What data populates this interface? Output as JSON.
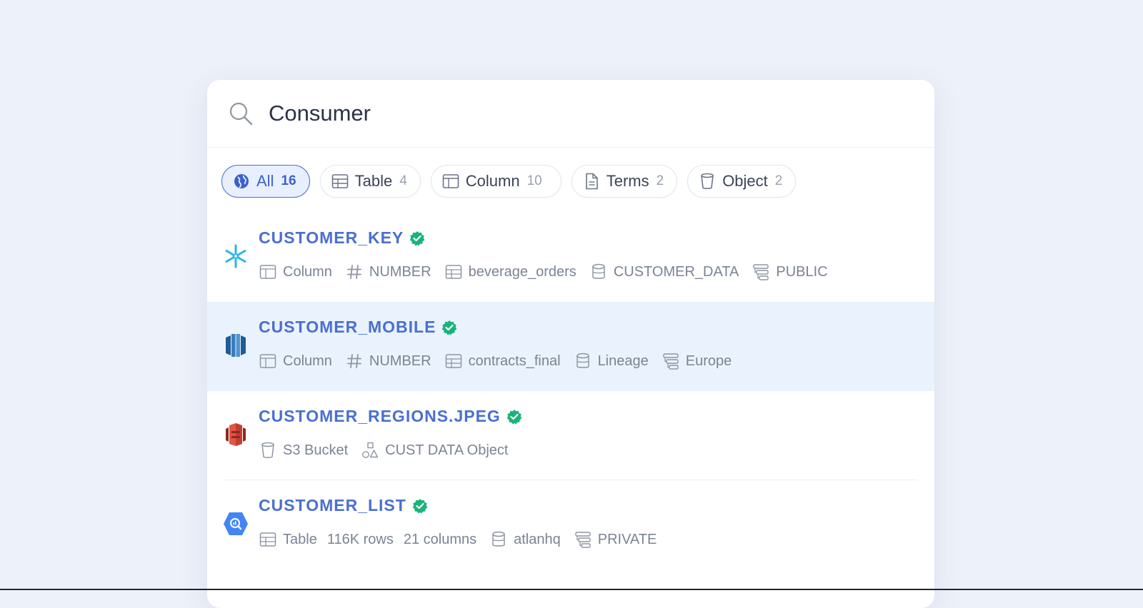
{
  "search": {
    "query": "Consumer",
    "icon": "search-icon"
  },
  "filters": [
    {
      "label": "All",
      "count": "16",
      "icon": "globe-icon"
    },
    {
      "label": "Table",
      "count": "4",
      "icon": "table-icon"
    },
    {
      "label": "Column",
      "count": "10",
      "icon": "column-icon"
    },
    {
      "label": "Terms",
      "count": "2",
      "icon": "document-icon"
    },
    {
      "label": "Object",
      "count": "2",
      "icon": "bucket-icon"
    }
  ],
  "results": [
    {
      "title": "CUSTOMER_KEY",
      "source_icon": "snowflake-icon",
      "meta": [
        "Column",
        "NUMBER",
        "beverage_orders",
        "CUSTOMER_DATA",
        "PUBLIC"
      ]
    },
    {
      "title": "CUSTOMER_MOBILE",
      "source_icon": "redshift-icon",
      "meta": [
        "Column",
        "NUMBER",
        "contracts_final",
        "Lineage",
        "Europe"
      ]
    },
    {
      "title": "CUSTOMER_REGIONS.JPEG",
      "source_icon": "s3-icon",
      "meta": [
        "S3 Bucket",
        "CUST DATA Object"
      ]
    },
    {
      "title": "CUSTOMER_LIST",
      "source_icon": "bigquery-icon",
      "meta": [
        "Table",
        "116K rows",
        "21 columns",
        "atlanhq",
        "PRIVATE"
      ]
    }
  ],
  "colors": {
    "background": "#edf1f9",
    "accent": "#4a6fd0",
    "verified": "#1bb37a",
    "highlight_row": "#eaf3fd"
  }
}
